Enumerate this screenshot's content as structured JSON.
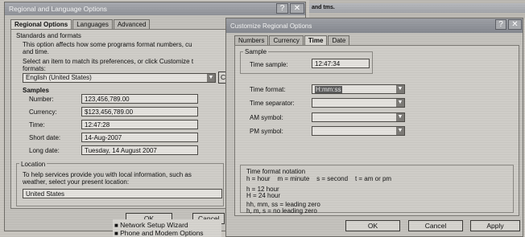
{
  "background_window": {
    "fragment_text": "and tms."
  },
  "regional_dialog": {
    "title": "Regional and Language Options",
    "tabs": [
      {
        "label": "Regional Options"
      },
      {
        "label": "Languages"
      },
      {
        "label": "Advanced"
      }
    ],
    "standards": {
      "group_label": "Standards and formats",
      "desc_line1": "This option affects how some programs format numbers, cu",
      "desc_line2": "and time.",
      "select_line1": "Select an item to match its preferences, or click Customize t",
      "select_line2": "formats:",
      "selected_format": "English (United States)",
      "customize_partial": "C"
    },
    "samples": {
      "label": "Samples",
      "rows": [
        {
          "label": "Number:",
          "value": "123,456,789.00"
        },
        {
          "label": "Currency:",
          "value": "$123,456,789.00"
        },
        {
          "label": "Time:",
          "value": "12:47:28"
        },
        {
          "label": "Short date:",
          "value": "14-Aug-2007"
        },
        {
          "label": "Long date:",
          "value": "Tuesday, 14 August 2007"
        }
      ]
    },
    "location": {
      "label": "Location",
      "desc_line1": "To help services provide you with local information, such as",
      "desc_line2": "weather, select your present location:",
      "value": "United States"
    },
    "buttons": {
      "ok": "OK",
      "cancel": "Cancel"
    }
  },
  "control_panel_list": {
    "items": [
      {
        "label": "Network Setup Wizard"
      },
      {
        "label": "Phone and Modem Options"
      }
    ]
  },
  "customize_dialog": {
    "title": "Customize Regional Options",
    "tabs": [
      {
        "label": "Numbers"
      },
      {
        "label": "Currency"
      },
      {
        "label": "Time"
      },
      {
        "label": "Date"
      }
    ],
    "sample": {
      "group_label": "Sample",
      "time_sample_label": "Time sample:",
      "time_sample_value": "12:47:34"
    },
    "fields": [
      {
        "label": "Time format:",
        "value": "H:mm:ss"
      },
      {
        "label": "Time separator:",
        "value": ""
      },
      {
        "label": "AM symbol:",
        "value": ""
      },
      {
        "label": "PM symbol:",
        "value": ""
      }
    ],
    "notation": {
      "title": "Time format notation",
      "line1": "h = hour    m = minute    s = second    t = am or pm",
      "line2": "h = 12 hour",
      "line3": "H = 24 hour",
      "line4": "hh, mm, ss = leading zero",
      "line5": "h, m, s = no leading zero"
    },
    "buttons": {
      "ok": "OK",
      "cancel": "Cancel",
      "apply": "Apply"
    }
  }
}
